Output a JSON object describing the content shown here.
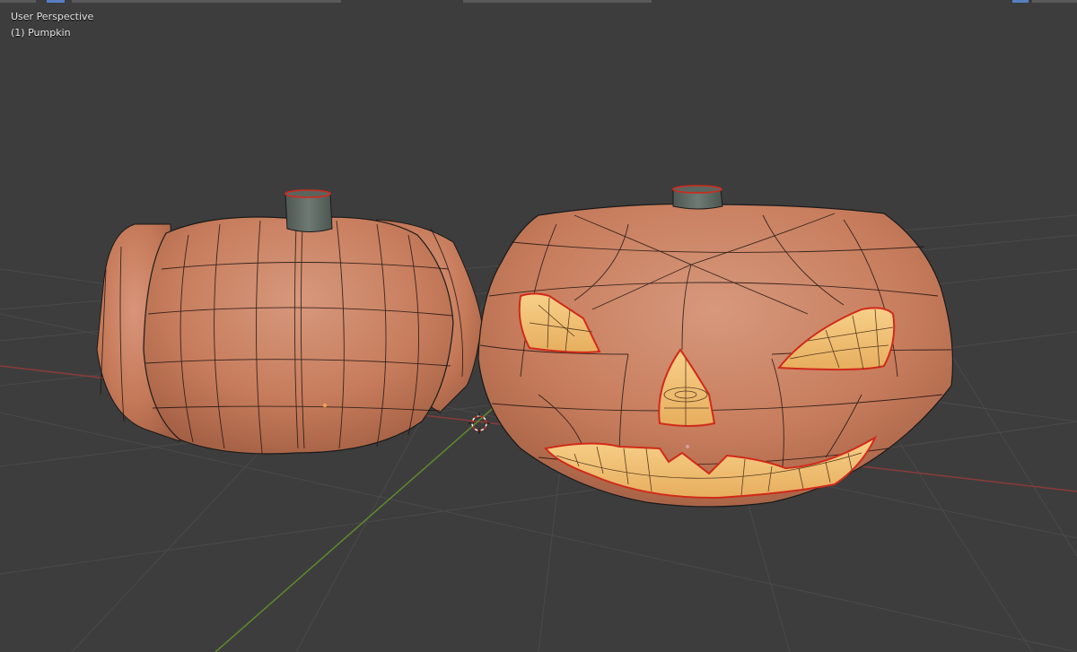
{
  "viewport": {
    "view_name": "User Perspective",
    "active_object": "(1) Pumpkin"
  },
  "colors": {
    "background": "#3d3d3d",
    "grid": "#4a4a4a",
    "x_axis": "#8a3b3b",
    "y_axis": "#5f8a2e",
    "pumpkin_skin": "#c97f5e",
    "pumpkin_outline": "#1a1a1a",
    "selection_edge": "#d02a1a",
    "carved_interior": "#f0c46e",
    "stem": "#5c6660"
  },
  "icons": {
    "cursor": "3d-cursor-icon",
    "origin": "object-origin-icon"
  }
}
